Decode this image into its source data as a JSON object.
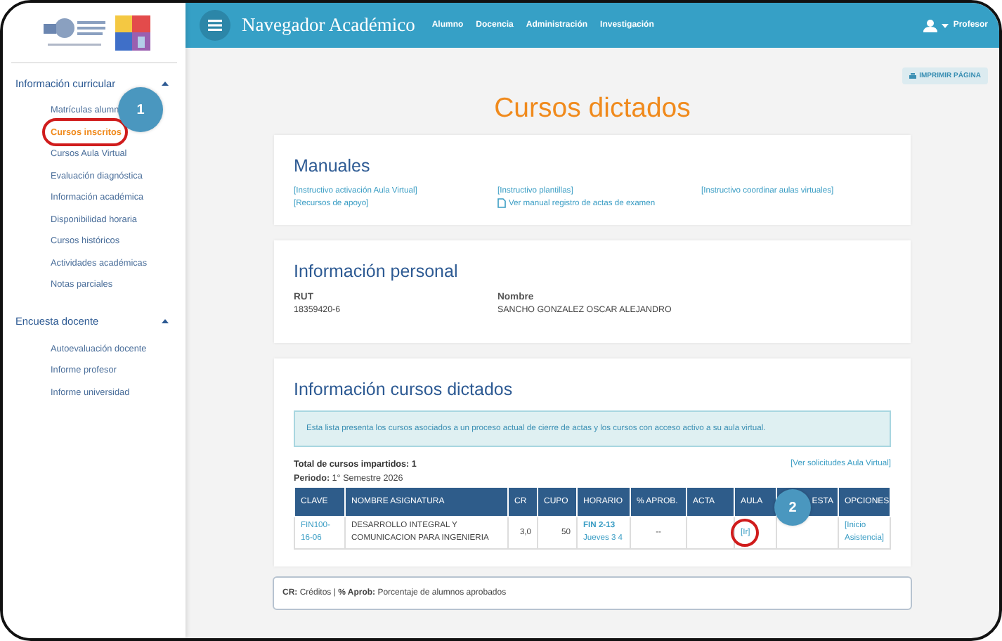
{
  "topbar": {
    "title": "Navegador Académico",
    "menu": [
      {
        "label": "Alumno"
      },
      {
        "label": "Docencia"
      },
      {
        "label": "Administración"
      },
      {
        "label": "Investigación"
      }
    ],
    "user": "Profesor"
  },
  "sidebar": {
    "sections": [
      {
        "label": "Información curricular",
        "expanded": true,
        "items": [
          {
            "label": "Matrículas alumn",
            "selected": false
          },
          {
            "label": "Cursos inscritos",
            "selected": true
          },
          {
            "label": "Cursos Aula Virtual",
            "selected": false
          },
          {
            "label": "Evaluación diagnóstica",
            "selected": false
          },
          {
            "label": "Información académica",
            "selected": false
          },
          {
            "label": "Disponibilidad horaria",
            "selected": false
          },
          {
            "label": "Cursos históricos",
            "selected": false
          },
          {
            "label": "Actividades académicas",
            "selected": false
          },
          {
            "label": "Notas parciales",
            "selected": false
          }
        ]
      },
      {
        "label": "Encuesta docente",
        "expanded": true,
        "items": [
          {
            "label": "Autoevaluación docente",
            "selected": false
          },
          {
            "label": "Informe profesor",
            "selected": false
          },
          {
            "label": "Informe universidad",
            "selected": false
          }
        ]
      }
    ]
  },
  "print_button": "IMPRIMIR PÁGINA",
  "page_title": "Cursos dictados",
  "manuales": {
    "title": "Manuales",
    "links": [
      {
        "kind": "link",
        "text": "[Instructivo activación Aula Virtual]"
      },
      {
        "kind": "link",
        "text": "[Instructivo plantillas]"
      },
      {
        "kind": "link",
        "text": "[Instructivo coordinar aulas virtuales]"
      },
      {
        "kind": "link",
        "text": "[Recursos de apoyo]"
      },
      {
        "kind": "pdf",
        "text": "Ver manual registro de actas de examen"
      }
    ]
  },
  "personal": {
    "title": "Información personal",
    "fields": [
      {
        "label": "RUT",
        "value": "18359420-6"
      },
      {
        "label": "Nombre",
        "value": "SANCHO GONZALEZ OSCAR ALEJANDRO"
      }
    ]
  },
  "cursos": {
    "title": "Información cursos dictados",
    "notice": "Esta lista presenta los cursos asociados a un proceso actual de cierre de actas y los cursos con acceso activo a su aula virtual.",
    "total": "Total de cursos impartidos: 1",
    "periodo": "**Periodo:** 1° Semestre 2026",
    "solicitudes_link": "[Ver solicitudes Aula Virtual]",
    "table": {
      "columns": [
        "CLAVE",
        "NOMBRE ASIGNATURA",
        "CR",
        "CUPO",
        "HORARIO",
        "% APROB.",
        "ACTA",
        "AULA",
        "ESTA",
        "OPCIONES"
      ],
      "rows": [
        {
          "cells": [
            {
              "kind": "link",
              "text": "FIN100-16-06"
            },
            {
              "kind": "text",
              "text": "DESARROLLO INTEGRAL Y COMUNICACION PARA INGENIERIA"
            },
            {
              "kind": "num",
              "text": "3,0"
            },
            {
              "kind": "num",
              "text": "50"
            },
            {
              "kind": "schedule",
              "room": "FIN 2-13",
              "time": "Jueves 3 4"
            },
            {
              "kind": "center",
              "text": "--"
            },
            {
              "kind": "empty"
            },
            {
              "kind": "link",
              "text": "[Ir]"
            },
            {
              "kind": "empty"
            },
            {
              "kind": "link",
              "text": "[Inicio Asistencia]"
            }
          ]
        }
      ]
    }
  },
  "legend": "**CR:** Créditos | **% Aprob:** Porcentaje de alumnos aprobados",
  "annotations": [
    {
      "kind": "bubble",
      "text": "1"
    },
    {
      "kind": "ring"
    },
    {
      "kind": "bubble",
      "text": "2"
    },
    {
      "kind": "ring"
    }
  ]
}
